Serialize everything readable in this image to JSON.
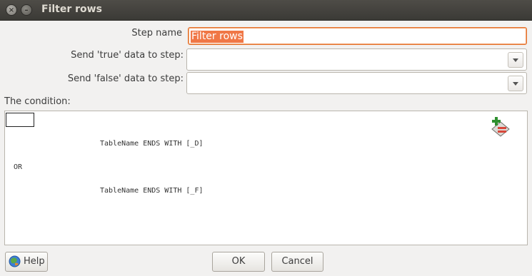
{
  "window": {
    "title": "Filter rows"
  },
  "form": {
    "step_name_label": "Step name",
    "step_name_value": "Filter rows",
    "true_step_label": "Send 'true' data to step:",
    "true_step_value": "",
    "false_step_label": "Send 'false' data to step:",
    "false_step_value": "",
    "condition_label": "The condition:"
  },
  "condition": {
    "lines": [
      "TableName ENDS WITH [_D]",
      "OR",
      "TableName ENDS WITH [_F]"
    ]
  },
  "buttons": {
    "help": "Help",
    "ok": "OK",
    "cancel": "Cancel"
  },
  "icons": {
    "close": "close-icon",
    "minimize": "minimize-icon",
    "add_condition": "add-condition-icon",
    "help": "help-icon"
  },
  "colors": {
    "accent": "#f07746",
    "titlebar": "#3f3e3a"
  }
}
